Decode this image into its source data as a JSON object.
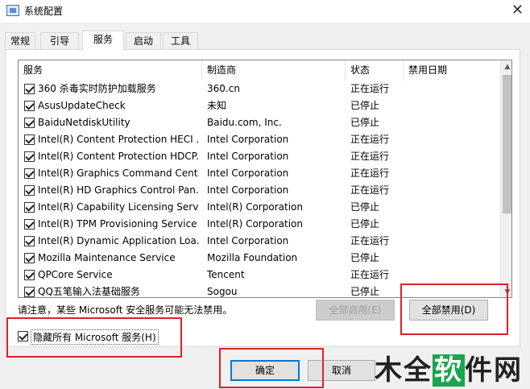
{
  "window": {
    "title": "系统配置",
    "close_glyph": "✕"
  },
  "tabs": [
    {
      "label": "常规"
    },
    {
      "label": "引导"
    },
    {
      "label": "服务"
    },
    {
      "label": "启动"
    },
    {
      "label": "工具"
    }
  ],
  "columns": [
    "服务",
    "制造商",
    "状态",
    "禁用日期"
  ],
  "services": [
    {
      "name": "360 杀毒实时防护加载服务",
      "maker": "360.cn",
      "status": "正在运行",
      "checked": true
    },
    {
      "name": "AsusUpdateCheck",
      "maker": "未知",
      "status": "已停止",
      "checked": true
    },
    {
      "name": "BaiduNetdiskUtility",
      "maker": "Baidu.com, Inc.",
      "status": "已停止",
      "checked": true
    },
    {
      "name": "Intel(R) Content Protection HECI ...",
      "maker": "Intel Corporation",
      "status": "正在运行",
      "checked": true
    },
    {
      "name": "Intel(R) Content Protection HDCP...",
      "maker": "Intel Corporation",
      "status": "正在运行",
      "checked": true
    },
    {
      "name": "Intel(R) Graphics Command Cent...",
      "maker": "Intel Corporation",
      "status": "正在运行",
      "checked": true
    },
    {
      "name": "Intel(R) HD Graphics Control Pan...",
      "maker": "Intel Corporation",
      "status": "正在运行",
      "checked": true
    },
    {
      "name": "Intel(R) Capability Licensing Servi...",
      "maker": "Intel(R) Corporation",
      "status": "已停止",
      "checked": true
    },
    {
      "name": "Intel(R) TPM Provisioning Service",
      "maker": "Intel(R) Corporation",
      "status": "已停止",
      "checked": true
    },
    {
      "name": "Intel(R) Dynamic Application Loa...",
      "maker": "Intel Corporation",
      "status": "正在运行",
      "checked": true
    },
    {
      "name": "Mozilla Maintenance Service",
      "maker": "Mozilla Foundation",
      "status": "已停止",
      "checked": true
    },
    {
      "name": "QPCore Service",
      "maker": "Tencent",
      "status": "正在运行",
      "checked": true
    },
    {
      "name": "QQ五笔输入法基础服务",
      "maker": "Sogou",
      "status": "已停止",
      "checked": true
    }
  ],
  "notice": "请注意，某些 Microsoft 安全服务可能无法禁用。",
  "buttons": {
    "enable_all": "全部启用(E)",
    "disable_all": "全部禁用(D)",
    "ok": "确定",
    "cancel": "取消"
  },
  "hide_ms": {
    "label": "隐藏所有 Microsoft 服务(H)",
    "checked": true
  },
  "watermark": {
    "text_a": "木",
    "text_b": "全",
    "text_c": "软",
    "text_d": "件",
    "text_e": "网"
  },
  "colors": {
    "highlight_box": "#e0202a",
    "accent": "#0078d7"
  }
}
